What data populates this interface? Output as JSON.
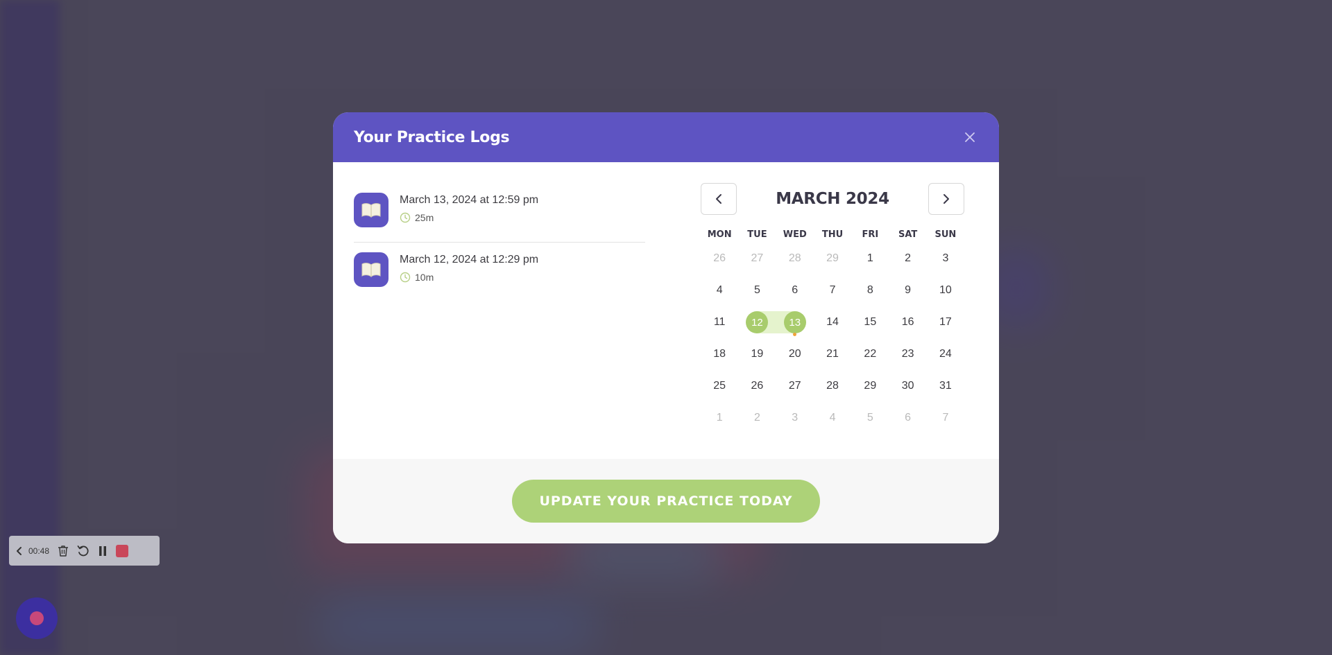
{
  "modal": {
    "title": "Your Practice Logs",
    "close_icon": "close-icon"
  },
  "logs": [
    {
      "date": "March 13, 2024 at 12:59 pm",
      "duration": "25m",
      "icon": "book-icon"
    },
    {
      "date": "March 12, 2024 at 12:29 pm",
      "duration": "10m",
      "icon": "book-icon"
    }
  ],
  "calendar": {
    "month_title": "MARCH 2024",
    "prev_icon": "chevron-left-icon",
    "next_icon": "chevron-right-icon",
    "weekdays": [
      "MON",
      "TUE",
      "WED",
      "THU",
      "FRI",
      "SAT",
      "SUN"
    ],
    "weeks": [
      [
        "26",
        "27",
        "28",
        "29",
        "1",
        "2",
        "3"
      ],
      [
        "4",
        "5",
        "6",
        "7",
        "8",
        "9",
        "10"
      ],
      [
        "11",
        "12",
        "13",
        "14",
        "15",
        "16",
        "17"
      ],
      [
        "18",
        "19",
        "20",
        "21",
        "22",
        "23",
        "24"
      ],
      [
        "25",
        "26",
        "27",
        "28",
        "29",
        "30",
        "31"
      ],
      [
        "1",
        "2",
        "3",
        "4",
        "5",
        "6",
        "7"
      ]
    ],
    "muted": [
      [
        0,
        0
      ],
      [
        0,
        1
      ],
      [
        0,
        2
      ],
      [
        0,
        3
      ],
      [
        5,
        0
      ],
      [
        5,
        1
      ],
      [
        5,
        2
      ],
      [
        5,
        3
      ],
      [
        5,
        4
      ],
      [
        5,
        5
      ],
      [
        5,
        6
      ]
    ],
    "selected": [
      [
        2,
        1
      ],
      [
        2,
        2
      ]
    ],
    "dot_marker": [
      2,
      2
    ],
    "selected_color": "#a8cc6c",
    "range_color": "#e5f3cd",
    "dot_color": "#f0a23a"
  },
  "footer": {
    "cta_label": "UPDATE YOUR PRACTICE TODAY",
    "cta_color": "#add278"
  },
  "recorder": {
    "time": "00:48",
    "back_icon": "chevron-left-icon",
    "delete_icon": "trash-icon",
    "restart_icon": "restart-icon",
    "pause_icon": "pause-icon",
    "stop_icon": "stop-icon",
    "record_icon": "record-icon"
  },
  "colors": {
    "header_bg": "#5e54c2",
    "accent": "#5e54c2"
  }
}
